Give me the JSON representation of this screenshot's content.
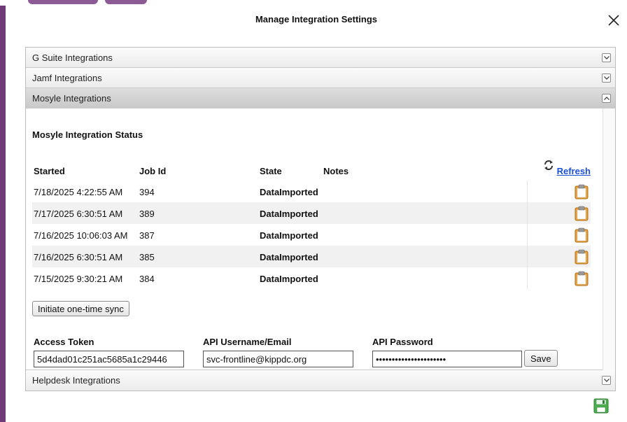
{
  "dialog": {
    "title": "Manage Integration Settings"
  },
  "sections": [
    {
      "label": "G Suite Integrations"
    },
    {
      "label": "Jamf Integrations"
    },
    {
      "label": "Mosyle Integrations"
    },
    {
      "label": "Helpdesk Integrations"
    }
  ],
  "mosyle": {
    "status_title": "Mosyle Integration Status",
    "columns": {
      "started": "Started",
      "job_id": "Job Id",
      "state": "State",
      "notes": "Notes"
    },
    "refresh_label": "Refresh",
    "jobs": [
      {
        "started": "7/18/2025 4:22:55 AM",
        "job_id": "394",
        "state": "DataImported",
        "notes": ""
      },
      {
        "started": "7/17/2025 6:30:51 AM",
        "job_id": "389",
        "state": "DataImported",
        "notes": ""
      },
      {
        "started": "7/16/2025 10:06:03 AM",
        "job_id": "387",
        "state": "DataImported",
        "notes": ""
      },
      {
        "started": "7/16/2025 6:30:51 AM",
        "job_id": "385",
        "state": "DataImported",
        "notes": ""
      },
      {
        "started": "7/15/2025 9:30:21 AM",
        "job_id": "384",
        "state": "DataImported",
        "notes": ""
      }
    ],
    "sync_button": "Initiate one-time sync",
    "access_token_label": "Access Token",
    "access_token_value": "5d4dad01c251ac5685a1c29446",
    "api_user_label": "API Username/Email",
    "api_user_value": "svc-frontline@kippdc.org",
    "api_password_label": "API Password",
    "api_password_value": "••••••••••••••••••••••",
    "save_label": "Save"
  },
  "colors": {
    "frame": "#6e3a78",
    "link": "#1b4fd6",
    "row_alt": "#f1f1f1",
    "save_disk": "#4caf50"
  },
  "icons": [
    "close-icon",
    "chevron-down-icon",
    "chevron-up-icon",
    "refresh-icon",
    "clipboard-icon",
    "save-disk-icon"
  ]
}
